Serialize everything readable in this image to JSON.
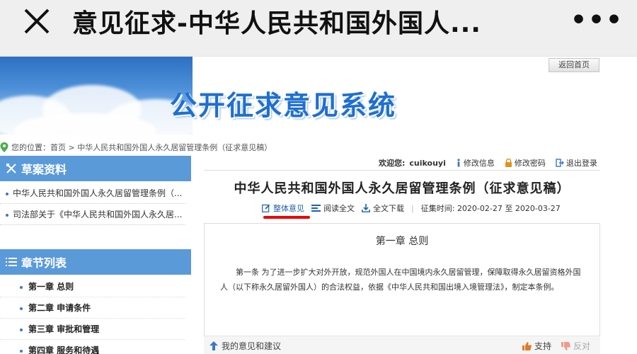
{
  "appbar": {
    "title": "意见征求-中华人民共和国外国人...",
    "more": "•••"
  },
  "banner": {
    "system_title": "公开征求意见系统",
    "home_button": "返回首页"
  },
  "breadcrumb": {
    "text": "您的位置：首页 > 中华人民共和国外国人永久居留管理条例（征求意见稿）"
  },
  "sidebar": {
    "drafts_heading": "草案资料",
    "drafts": [
      "中华人民共和国外国人永久居留管理条例（...",
      "司法部关于《中华人民共和国外国人永久居..."
    ],
    "chapters_heading": "章节列表",
    "chapters": [
      "第一章 总则",
      "第二章 申请条件",
      "第三章 审批和管理",
      "第四章 服务和待遇"
    ]
  },
  "user": {
    "welcome_label": "欢迎您:",
    "username": "cuikouyi",
    "edit_info": "修改信息",
    "change_password": "修改密码",
    "logout": "退出登录"
  },
  "document": {
    "title": "中华人民共和国外国人永久居留管理条例（征求意见稿）",
    "overall_opinion": "整体意见",
    "read_full": "阅读全文",
    "download_full": "全文下载",
    "period_label": "征集时间:",
    "start_date": "2020-02-27",
    "to": "至",
    "end_date": "2020-03-27"
  },
  "article": {
    "chapter_title": "第一章 总则",
    "body": "第一条 为了进一步扩大对外开放，规范外国人在中国境内永久居留管理，保障取得永久居留资格外国人（以下称永久居留外国人）的合法权益，依据《中华人民共和国出境入境管理法》，制定本条例。"
  },
  "feedback": {
    "my_opinion": "我的意见和建议",
    "support": "支持",
    "oppose": "反对"
  },
  "colors": {
    "accent": "#5b9ad9",
    "title_blue": "#1f6fd0",
    "underline_red": "#e00000"
  }
}
